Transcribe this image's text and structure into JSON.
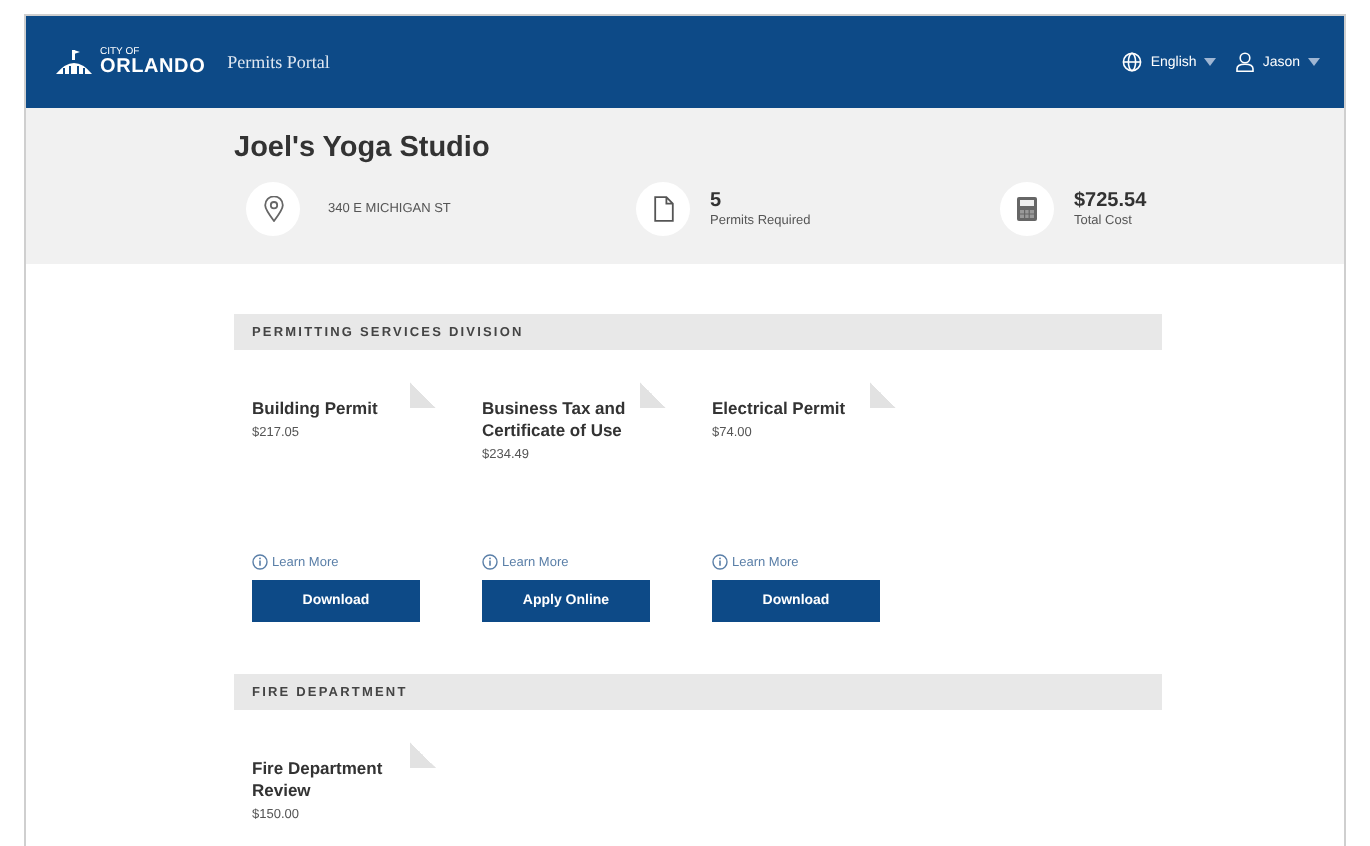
{
  "header": {
    "logo_small": "CITY OF",
    "logo_large": "ORLANDO",
    "portal_title": "Permits Portal",
    "language": "English",
    "user": "Jason"
  },
  "business": {
    "name": "Joel's Yoga Studio",
    "stats": [
      {
        "kind": "location",
        "value": "340 E MICHIGAN ST"
      },
      {
        "kind": "permits",
        "value": "5",
        "label": "Permits Required"
      },
      {
        "kind": "cost",
        "value": "$725.54",
        "label": "Total Cost"
      }
    ]
  },
  "sections": [
    {
      "title": "PERMITTING SERVICES DIVISION",
      "permits": [
        {
          "name": "Building Permit",
          "price": "$217.05",
          "link": "Learn More",
          "action": "Download"
        },
        {
          "name": "Business Tax and Certificate of Use",
          "price": "$234.49",
          "link": "Learn More",
          "action": "Apply Online"
        },
        {
          "name": "Electrical Permit",
          "price": "$74.00",
          "link": "Learn More",
          "action": "Download"
        }
      ]
    },
    {
      "title": "FIRE DEPARTMENT",
      "permits": [
        {
          "name": "Fire Department Review",
          "price": "$150.00"
        }
      ]
    }
  ]
}
